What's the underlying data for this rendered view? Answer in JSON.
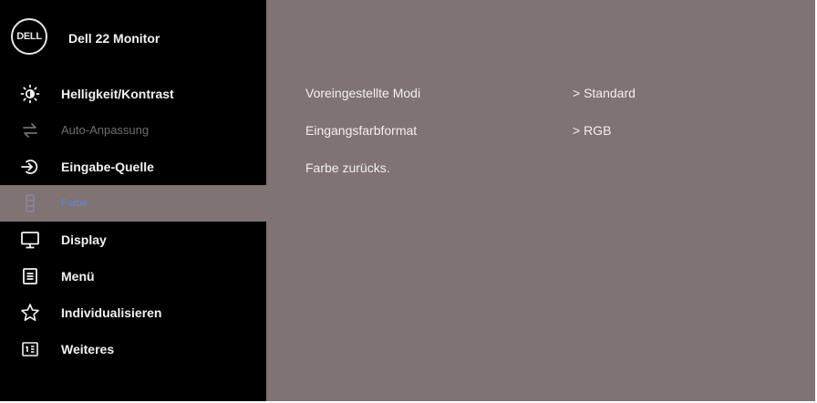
{
  "brand": {
    "logo_text": "DΕLL",
    "model": "Dell 22 Monitor"
  },
  "menu": {
    "items": [
      {
        "label": "Helligkeit/Kontrast",
        "icon": "brightness-icon",
        "state": "normal"
      },
      {
        "label": "Auto-Anpassung",
        "icon": "auto-adjust-icon",
        "state": "disabled"
      },
      {
        "label": "Eingabe-Quelle",
        "icon": "input-source-icon",
        "state": "normal"
      },
      {
        "label": "Farbe",
        "icon": "color-icon",
        "state": "active"
      },
      {
        "label": "Display",
        "icon": "display-icon",
        "state": "normal"
      },
      {
        "label": "Menü",
        "icon": "menu-icon",
        "state": "normal"
      },
      {
        "label": "Individualisieren",
        "icon": "star-icon",
        "state": "normal"
      },
      {
        "label": "Weiteres",
        "icon": "others-icon",
        "state": "normal"
      }
    ]
  },
  "content": {
    "rows": [
      {
        "label": "Voreingestellte Modi",
        "value": "> Standard"
      },
      {
        "label": "Eingangsfarbformat",
        "value": "> RGB"
      },
      {
        "label": "Farbe zurücks.",
        "value": ""
      }
    ]
  },
  "colors": {
    "sidebar_bg": "#000000",
    "content_bg": "#7f7373",
    "active_item_text": "#5f87d8",
    "disabled_text": "#6e6e6e",
    "text": "#f2f2f2"
  }
}
